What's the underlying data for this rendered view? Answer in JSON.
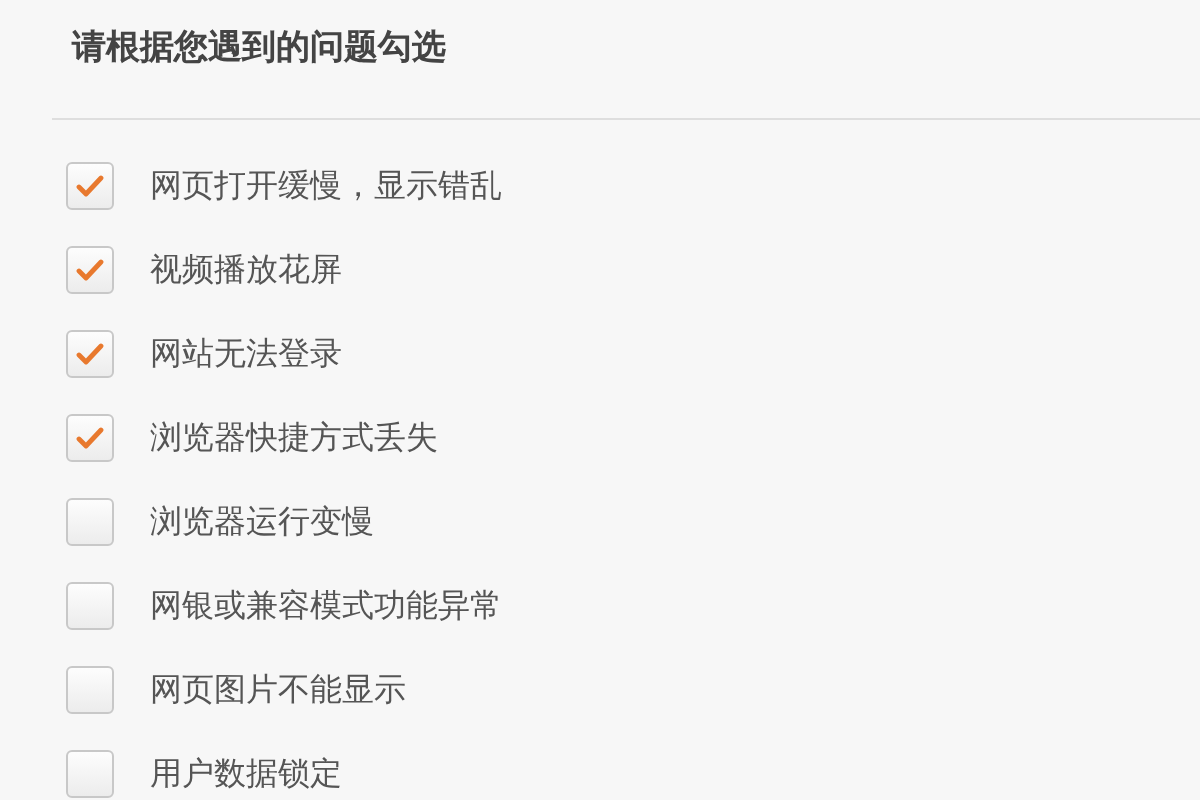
{
  "title": "请根据您遇到的问题勾选",
  "options": [
    {
      "label": "网页打开缓慢，显示错乱",
      "checked": true
    },
    {
      "label": "视频播放花屏",
      "checked": true
    },
    {
      "label": "网站无法登录",
      "checked": true
    },
    {
      "label": "浏览器快捷方式丢失",
      "checked": true
    },
    {
      "label": "浏览器运行变慢",
      "checked": false
    },
    {
      "label": "网银或兼容模式功能异常",
      "checked": false
    },
    {
      "label": "网页图片不能显示",
      "checked": false
    },
    {
      "label": "用户数据锁定",
      "checked": false
    }
  ]
}
